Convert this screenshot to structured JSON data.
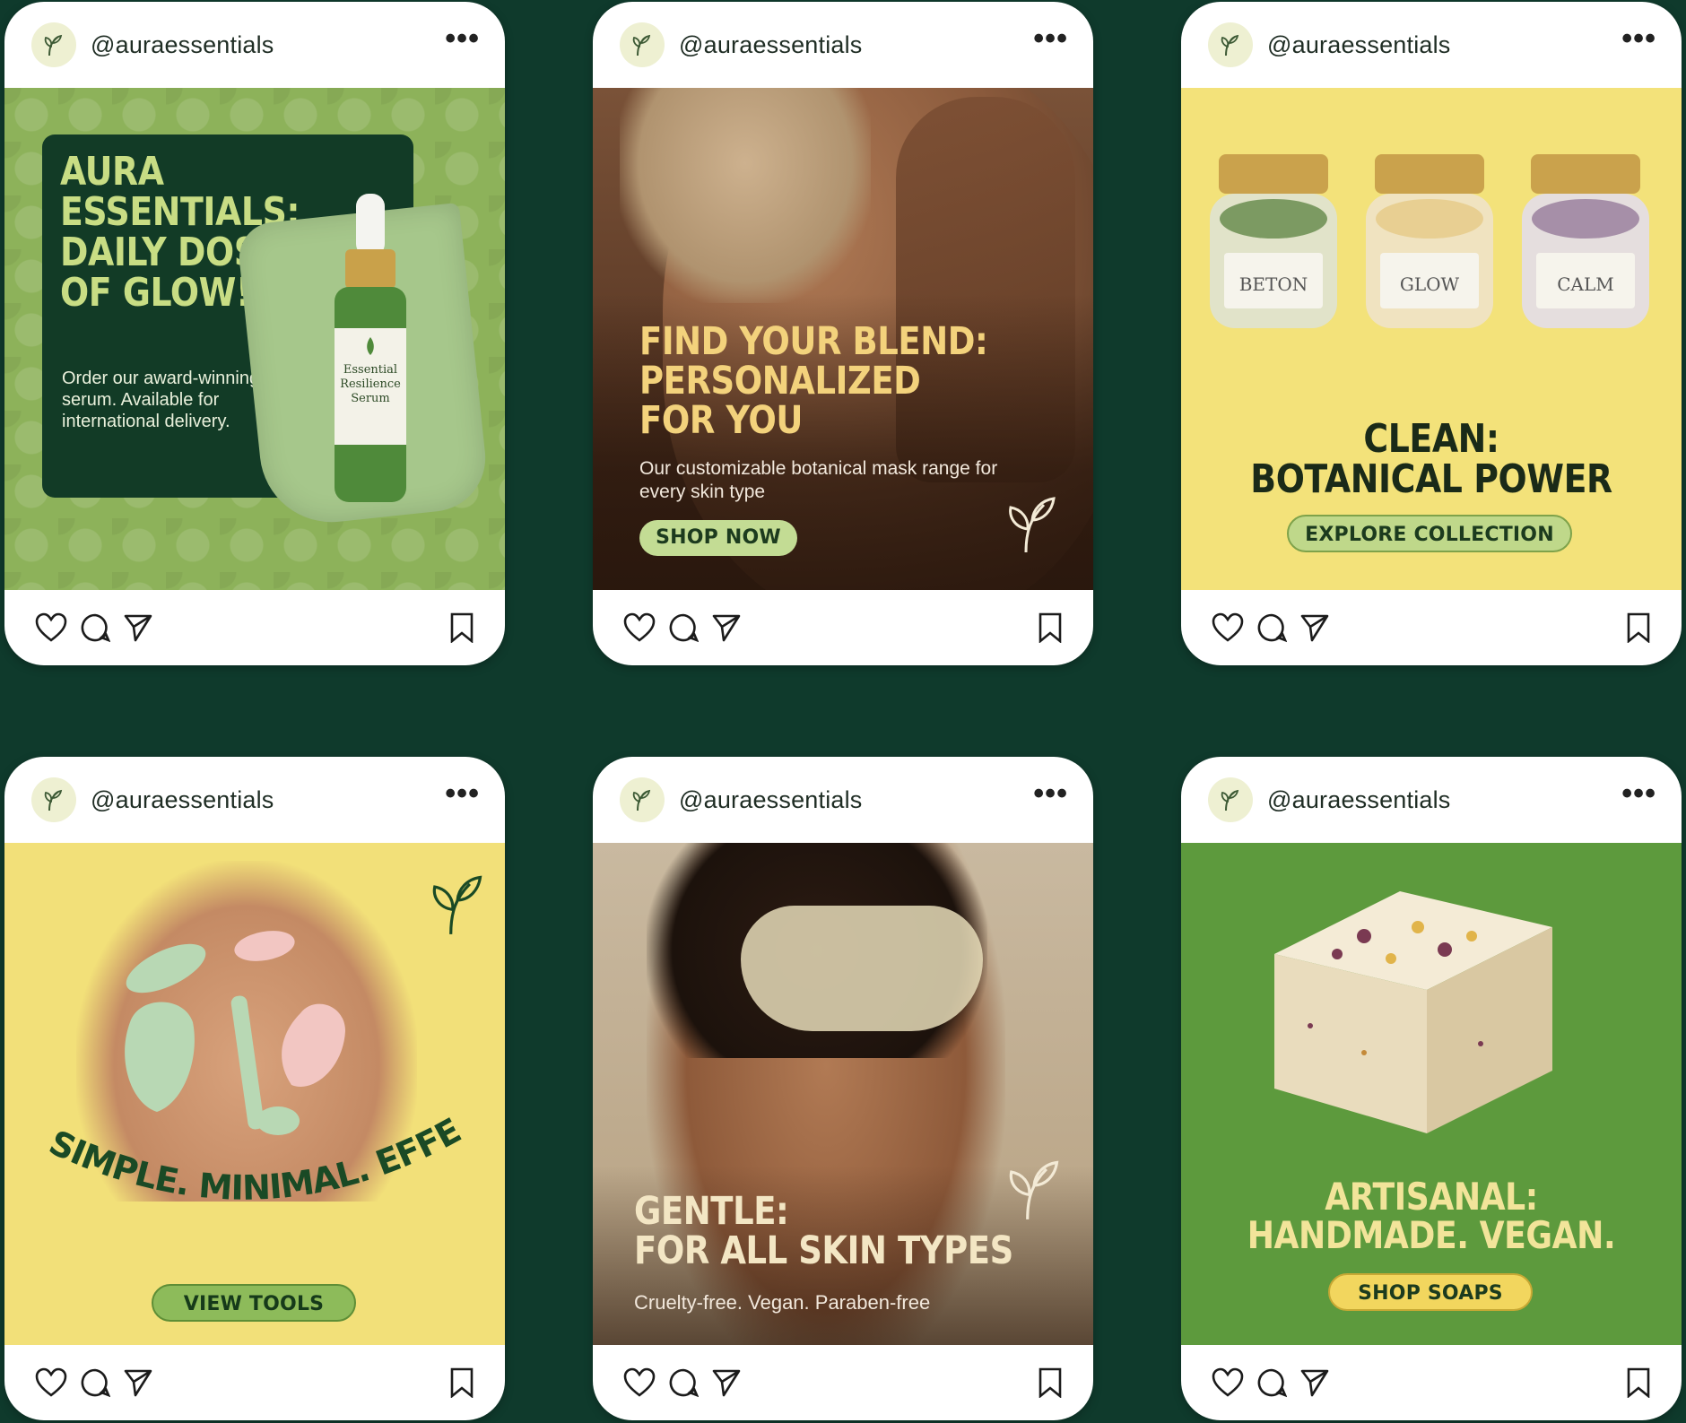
{
  "posts": [
    {
      "handle": "@auraessentials",
      "headline": "AURA\nESSENTIALS:\nDAILY DOSE\nOF GLOW!",
      "subtext": "Order our award-winning serum. Available for international delivery.",
      "label": "Essential\nResilience\nSerum"
    },
    {
      "handle": "@auraessentials",
      "headline": "FIND YOUR BLEND:\nPERSONALIZED\nFOR YOU",
      "subtext": "Our customizable botanical mask range for every skin type",
      "cta": "SHOP NOW"
    },
    {
      "handle": "@auraessentials",
      "jars": [
        "BETON",
        "GLOW",
        "CALM"
      ],
      "headline": "CLEAN:\nBOTANICAL POWER",
      "cta": "EXPLORE COLLECTION"
    },
    {
      "handle": "@auraessentials",
      "headline": "AURA: SIMPLE. MINIMAL. EFFECTIVE.",
      "cta": "VIEW TOOLS"
    },
    {
      "handle": "@auraessentials",
      "headline": "GENTLE:\nFOR ALL SKIN TYPES",
      "subtext": "Cruelty-free. Vegan. Paraben-free"
    },
    {
      "handle": "@auraessentials",
      "headline": "ARTISANAL:\nHANDMADE. VEGAN.",
      "cta": "SHOP SOAPS"
    }
  ],
  "icons": {
    "avatar": "leaf-icon",
    "more": "more-options-icon",
    "like": "heart-icon",
    "comment": "comment-icon",
    "share": "send-icon",
    "save": "bookmark-icon"
  },
  "colors": {
    "background": "#0f3a2c",
    "card": "#ffffff",
    "brand_green": "#123b26",
    "yellow": "#f3e27a",
    "olive": "#8db25a"
  }
}
